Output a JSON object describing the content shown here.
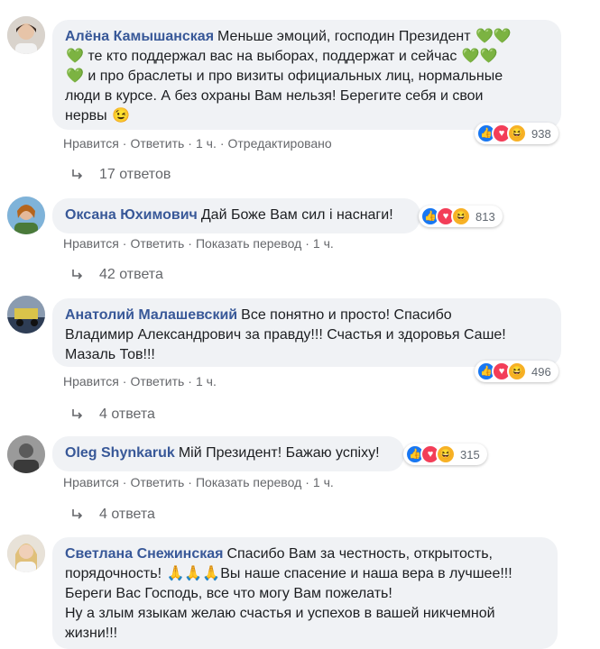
{
  "comments": [
    {
      "author": "Алёна Камышанская",
      "text": "Меньше эмоций, господин Президент 💚💚 💚 те кто поддержал вас на выборах, поддержат и сейчас 💚💚 💚 и про браслеты и про визиты официальных лиц, нормальные люди в курсе. А без охраны Вам нельзя! Берегите себя и свои нервы 😉",
      "lines": [
        "Меньше эмоций, господин Президент",
        "те кто поддержал вас на выборах, поддержат и сейчас",
        "и про браслеты и про визиты официальных лиц, нормальные",
        "люди в курсе. А без охраны Вам нельзя! Берегите себя и свои",
        "нервы"
      ],
      "emoji": [
        "💚💚",
        "💚",
        "💚💚",
        "💚",
        "😉"
      ],
      "reaction_count": "938",
      "action_like": "Нравится",
      "action_reply": "Ответить",
      "time": "1 ч.",
      "edited": "Отредактировано",
      "replies_label": "17 ответов"
    },
    {
      "author": "Оксана Юхимович",
      "text": "Дай Боже Вам сил і наснаги!",
      "reaction_count": "813",
      "action_like": "Нравится",
      "action_reply": "Ответить",
      "action_translate": "Показать перевод",
      "time": "1 ч.",
      "replies_label": "42 ответа"
    },
    {
      "author": "Анатолий Малашевский",
      "lines": [
        "Все понятно и просто! Спасибо",
        "Владимир Александрович за правду!!! Счастья и здоровья Саше!",
        "Мазаль Тов!!!"
      ],
      "reaction_count": "496",
      "action_like": "Нравится",
      "action_reply": "Ответить",
      "time": "1 ч.",
      "replies_label": "4 ответа"
    },
    {
      "author": "Oleg Shynkaruk",
      "text": "Мій Президент! Бажаю успіху!",
      "reaction_count": "315",
      "action_like": "Нравится",
      "action_reply": "Ответить",
      "action_translate": "Показать перевод",
      "time": "1 ч.",
      "replies_label": "4 ответа"
    },
    {
      "author": "Светлана Снежинская",
      "lines": [
        "Спасибо Вам за честность, открытость,",
        "порядочность!",
        "Вы наше спасение и наша вера в лучшее!!!",
        "Береги Вас Господь, все что могу Вам пожелать!",
        "Ну а злым языкам желаю счастья и успехов в вашей никчемной",
        "жизни!!!"
      ],
      "emoji": [
        "🙏🙏🙏"
      ]
    }
  ],
  "icons": {
    "reply_arrow": "reply-arrow-icon",
    "like": "like-reaction-icon",
    "love": "love-reaction-icon",
    "haha": "haha-reaction-icon"
  },
  "colors": {
    "author": "#385898",
    "bubble": "#f0f2f5",
    "meta": "#65676b",
    "like": "#1877f2",
    "love": "#f33e58",
    "haha": "#f7b125"
  }
}
